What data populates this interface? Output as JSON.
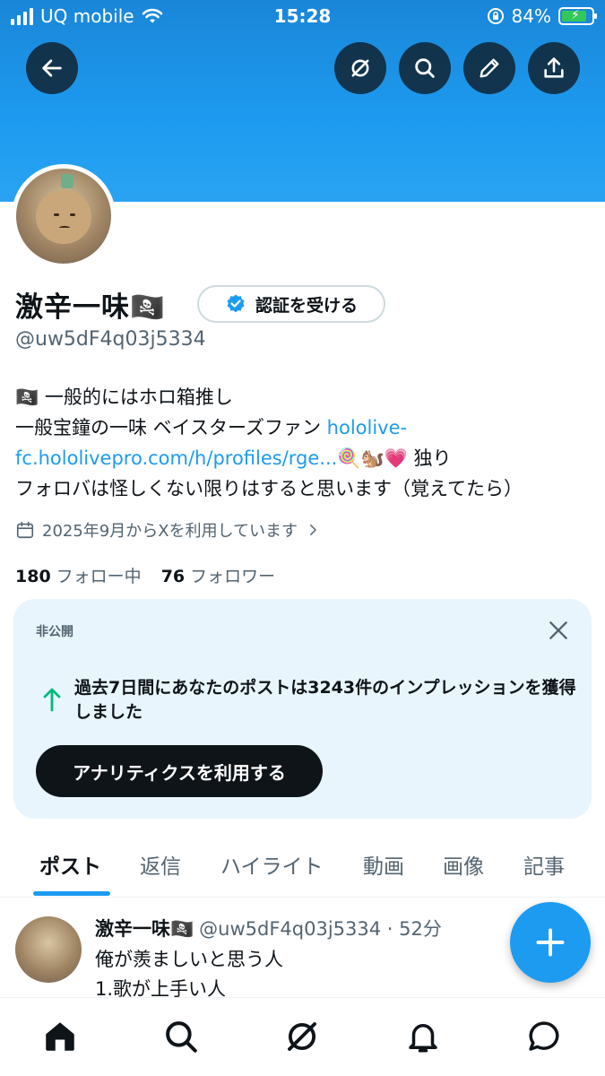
{
  "status_bar": {
    "carrier": "UQ mobile",
    "time": "15:28",
    "battery": "84%"
  },
  "header_icons": [
    "back-arrow-icon",
    "grok-icon",
    "search-icon",
    "edit-pencil-icon",
    "share-icon"
  ],
  "profile": {
    "name": "激辛一味🏴‍☠️",
    "verify_button": "認証を受ける",
    "handle": "@uw5dF4q03j5334",
    "bio_line1": "🏴‍☠️ 一般的にはホロ箱推し",
    "bio_line2_text": "一般宝鐘の一味 ベイスターズファン ",
    "bio_link_part1": "hololive-",
    "bio_link_part2": "fc.hololivepro.com/h/profiles/rge...",
    "bio_line3_rest": "🍭🐿️💗 独り",
    "bio_line4": "フォロバは怪しくない限りはすると思います（覚えてたら）",
    "joined": "2025年9月からXを利用しています",
    "following_count": "180",
    "following_label": "フォロー中",
    "followers_count": "76",
    "followers_label": "フォロワー"
  },
  "analytics_card": {
    "private_label": "非公開",
    "message": "過去7日間にあなたのポストは3243件のインプレッションを獲得しました",
    "cta": "アナリティクスを利用する"
  },
  "tabs": [
    "ポスト",
    "返信",
    "ハイライト",
    "動画",
    "画像",
    "記事"
  ],
  "active_tab": "ポスト",
  "post": {
    "name": "激辛一味🏴‍☠️",
    "meta": "@uw5dF4q03j5334 · 52分",
    "line1": "俺が羨ましいと思う人",
    "line2": "1.歌が上手い人"
  },
  "bottom_nav": [
    "home-icon",
    "search-icon",
    "grok-icon",
    "notifications-icon",
    "messages-icon"
  ],
  "colors": {
    "accent": "#1d9bf0",
    "text": "#0f1419",
    "muted": "#536471",
    "card_bg": "#e8f5fd",
    "up_arrow": "#00ba7c"
  }
}
